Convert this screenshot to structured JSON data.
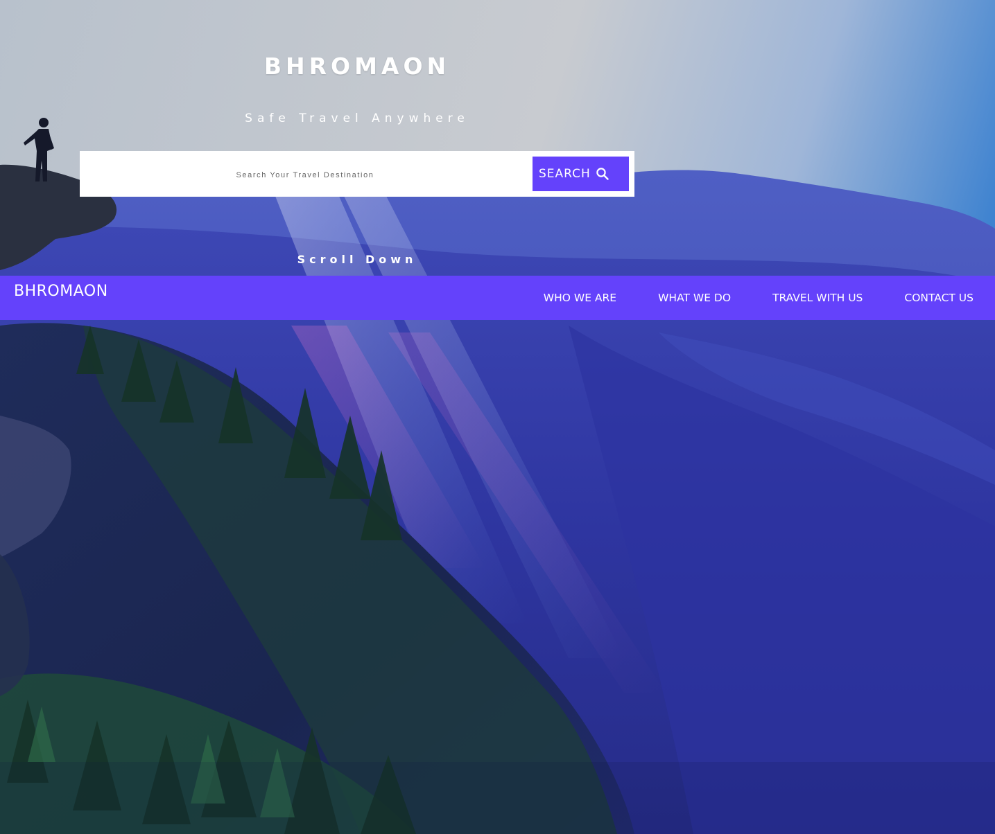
{
  "hero": {
    "title": "BHROMAON",
    "tagline": "Safe Travel Anywhere",
    "scroll_label": "Scroll Down"
  },
  "search": {
    "placeholder": "Search Your Travel Destination",
    "value": "",
    "button_label": "SEARCH",
    "button_icon": "search-icon"
  },
  "navbar": {
    "brand": "BHROMAON",
    "links": [
      {
        "label": "WHO WE ARE"
      },
      {
        "label": "WHAT WE DO"
      },
      {
        "label": "TRAVEL WITH US"
      },
      {
        "label": "CONTACT US"
      }
    ]
  },
  "colors": {
    "accent": "#6442fb",
    "text_light": "#ffffff",
    "sky_top": "#c9ccd3",
    "mountain_blue": "#3a3fb8"
  }
}
